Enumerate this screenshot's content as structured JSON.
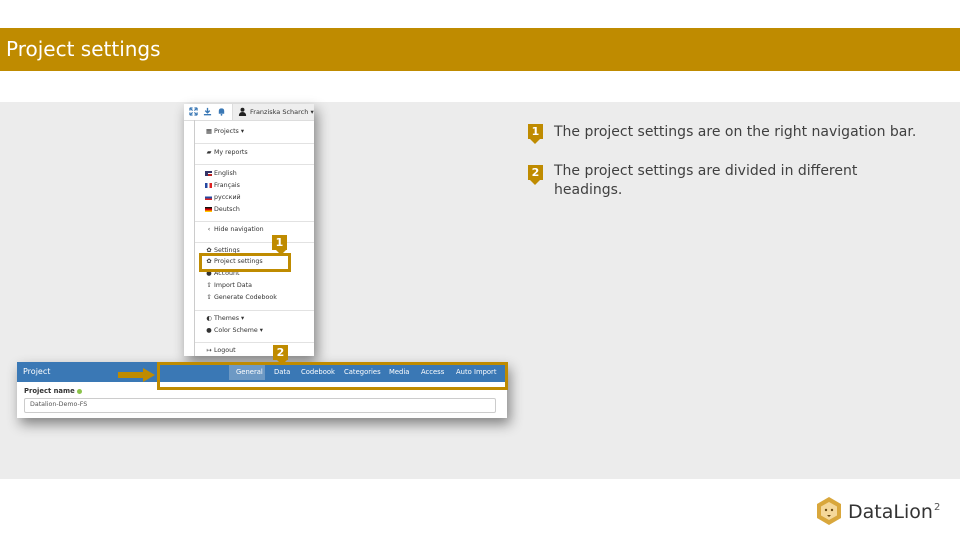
{
  "slide": {
    "title": "Project settings",
    "page_number": "2",
    "brand": "DataLion"
  },
  "colors": {
    "accent": "#bf8b00",
    "header_blue": "#3a78b5",
    "band": "#ececec"
  },
  "menu": {
    "user_name": "Franziska Scharch",
    "toolbar_icons": [
      "fullscreen-icon",
      "download-icon",
      "bell-icon",
      "user-icon"
    ],
    "items": {
      "projects": "Projects",
      "my_reports": "My reports",
      "english": "English",
      "francais": "Français",
      "russian": "русский",
      "deutsch": "Deutsch",
      "hide_navigation": "Hide navigation",
      "settings": "Settings",
      "project_settings": "Project settings",
      "account": "Account",
      "import_data": "Import Data",
      "generate_codebook": "Generate Codebook",
      "themes": "Themes",
      "color_scheme": "Color Scheme",
      "logout": "Logout"
    }
  },
  "project_panel": {
    "title": "Project",
    "tabs": [
      "General",
      "Data",
      "Codebook",
      "Categories",
      "Media",
      "Access",
      "Auto Import"
    ],
    "active_tab": "General",
    "field_label": "Project name",
    "field_value": "Datalion-Demo-FS"
  },
  "callouts": {
    "badge_1": "1",
    "badge_2": "2",
    "note_1": "The project settings are on the right navigation bar.",
    "note_2_line1": "The project settings are divided in different",
    "note_2_line2": "headings."
  }
}
